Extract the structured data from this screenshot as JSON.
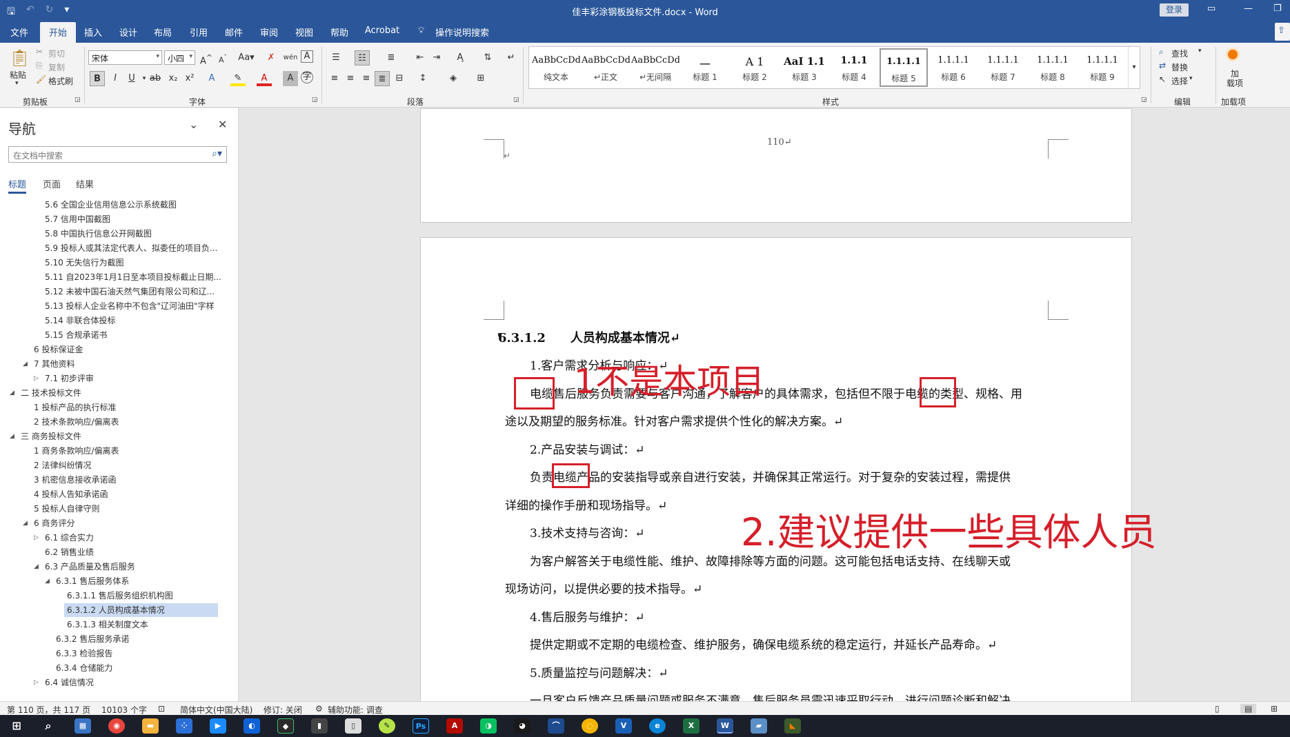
{
  "window": {
    "title": "佳丰彩涂钢板投标文件.docx  -  Word",
    "login_label": "登录",
    "quick_access": [
      "save-icon",
      "undo-icon",
      "redo-icon",
      "customize-icon"
    ]
  },
  "tabs": [
    "文件",
    "开始",
    "插入",
    "设计",
    "布局",
    "引用",
    "邮件",
    "审阅",
    "视图",
    "帮助",
    "Acrobat"
  ],
  "active_tab": "开始",
  "tell_me": "操作说明搜索",
  "ribbon": {
    "clipboard": {
      "paste": "粘贴",
      "cut": "剪切",
      "copy": "复制",
      "format_painter": "格式刷",
      "label": "剪贴板"
    },
    "font": {
      "name": "宋体",
      "size": "小四",
      "label": "字体"
    },
    "paragraph": {
      "label": "段落"
    },
    "styles": {
      "label": "样式",
      "items": [
        {
          "preview": "AaBbCcDdI",
          "name": "纯文本"
        },
        {
          "preview": "AaBbCcDdI",
          "name": "↵正文"
        },
        {
          "preview": "AaBbCcDdI",
          "name": "↵无间隔"
        },
        {
          "preview": "一",
          "name": "标题 1"
        },
        {
          "preview": "A 1",
          "name": "标题 2"
        },
        {
          "preview": "AaI 1.1",
          "name": "标题 3"
        },
        {
          "preview": "1.1.1",
          "name": "标题 4"
        },
        {
          "preview": "1.1.1.1",
          "name": "标题 5"
        },
        {
          "preview": "1.1.1.1",
          "name": "标题 6"
        },
        {
          "preview": "1.1.1.1",
          "name": "标题 7"
        },
        {
          "preview": "1.1.1.1",
          "name": "标题 8"
        },
        {
          "preview": "1.1.1.1",
          "name": "标题 9"
        }
      ],
      "selected_index": 7
    },
    "editing": {
      "find": "查找",
      "replace": "替换",
      "select": "选择",
      "label": "编辑"
    },
    "addins": {
      "button": "加\n载项",
      "label": "加载项"
    }
  },
  "nav": {
    "title": "导航",
    "search_placeholder": "在文档中搜索",
    "tabs": [
      "标题",
      "页面",
      "结果"
    ],
    "items": [
      {
        "text": "5.6 全国企业信用信息公示系统截图",
        "level": 3,
        "tri": ""
      },
      {
        "text": "5.7 信用中国截图",
        "level": 3,
        "tri": ""
      },
      {
        "text": "5.8 中国执行信息公开网截图",
        "level": 3,
        "tri": ""
      },
      {
        "text": "5.9 投标人或其法定代表人、拟委任的项目负...",
        "level": 3,
        "tri": ""
      },
      {
        "text": "5.10 无失信行为截图",
        "level": 3,
        "tri": ""
      },
      {
        "text": "5.11 自2023年1月1日至本项目投标截止日期...",
        "level": 3,
        "tri": ""
      },
      {
        "text": "5.12 未被中国石油天然气集团有限公司和辽...",
        "level": 3,
        "tri": ""
      },
      {
        "text": "5.13 投标人企业名称中不包含\"辽河油田\"字样",
        "level": 3,
        "tri": ""
      },
      {
        "text": "5.14 非联合体投标",
        "level": 3,
        "tri": ""
      },
      {
        "text": "5.15 合规承诺书",
        "level": 3,
        "tri": ""
      },
      {
        "text": "6 投标保证金",
        "level": 2,
        "tri": ""
      },
      {
        "text": "7 其他资料",
        "level": 2,
        "tri": "open"
      },
      {
        "text": "7.1 初步评审",
        "level": 3,
        "tri": "closed"
      },
      {
        "text": "二 技术投标文件",
        "level": 1,
        "tri": "open"
      },
      {
        "text": "1 投标产品的执行标准",
        "level": 2,
        "tri": ""
      },
      {
        "text": "2 技术条款响应/偏离表",
        "level": 2,
        "tri": ""
      },
      {
        "text": "三 商务投标文件",
        "level": 1,
        "tri": "open"
      },
      {
        "text": "1 商务条款响应/偏离表",
        "level": 2,
        "tri": ""
      },
      {
        "text": "2 法律纠纷情况",
        "level": 2,
        "tri": ""
      },
      {
        "text": "3 机密信息接收承诺函",
        "level": 2,
        "tri": ""
      },
      {
        "text": "4 投标人告知承诺函",
        "level": 2,
        "tri": ""
      },
      {
        "text": "5 投标人自律守则",
        "level": 2,
        "tri": ""
      },
      {
        "text": "6 商务评分",
        "level": 2,
        "tri": "open"
      },
      {
        "text": "6.1 综合实力",
        "level": 3,
        "tri": "closed"
      },
      {
        "text": "6.2 销售业绩",
        "level": 3,
        "tri": ""
      },
      {
        "text": "6.3 产品质量及售后服务",
        "level": 3,
        "tri": "open"
      },
      {
        "text": "6.3.1 售后服务体系",
        "level": 4,
        "tri": "open"
      },
      {
        "text": "6.3.1.1 售后服务组织机构图",
        "level": 5,
        "tri": ""
      },
      {
        "text": "6.3.1.2 人员构成基本情况",
        "level": 5,
        "tri": "",
        "selected": true
      },
      {
        "text": "6.3.1.3 相关制度文本",
        "level": 5,
        "tri": ""
      },
      {
        "text": "6.3.2 售后服务承诺",
        "level": 4,
        "tri": ""
      },
      {
        "text": "6.3.3 检验报告",
        "level": 4,
        "tri": ""
      },
      {
        "text": "6.3.4 仓储能力",
        "level": 4,
        "tri": ""
      },
      {
        "text": "6.4 诚信情况",
        "level": 3,
        "tri": "closed"
      }
    ]
  },
  "document": {
    "page_number": "110↵",
    "heading": "6.3.1.2　　人员构成基本情况↵",
    "paragraphs": [
      {
        "text": "1.客户需求分析与响应：↵",
        "indent": true
      },
      {
        "text": "电缆售后服务负责需要与客户沟通，了解客户的具体需求，包括但不限于电缆的类型、规格、用",
        "indent": true
      },
      {
        "text": "途以及期望的服务标准。针对客户需求提供个性化的解决方案。↵",
        "indent": false
      },
      {
        "text": "2.产品安装与调试：↵",
        "indent": true
      },
      {
        "text": "负责电缆产品的安装指导或亲自进行安装，并确保其正常运行。对于复杂的安装过程，需提供",
        "indent": true
      },
      {
        "text": "详细的操作手册和现场指导。↵",
        "indent": false
      },
      {
        "text": "3.技术支持与咨询：↵",
        "indent": true
      },
      {
        "text": "为客户解答关于电缆性能、维护、故障排除等方面的问题。这可能包括电话支持、在线聊天或",
        "indent": true
      },
      {
        "text": "现场访问，以提供必要的技术指导。↵",
        "indent": false
      },
      {
        "text": "4.售后服务与维护：↵",
        "indent": true
      },
      {
        "text": "提供定期或不定期的电缆检查、维护服务，确保电缆系统的稳定运行，并延长产品寿命。↵",
        "indent": true
      },
      {
        "text": "5.质量监控与问题解决：↵",
        "indent": true
      },
      {
        "text": "一旦客户反馈产品质量问题或服务不满意，售后服务员需迅速采取行动，进行问题诊断和解决",
        "indent": true
      }
    ],
    "annotations": [
      "1不是本项目",
      "2.建议提供一些具体人员"
    ],
    "annotation_color": "#d51f2a"
  },
  "status": {
    "page": "第 110 页，共 117 页",
    "words": "10103 个字",
    "language": "简体中文(中国大陆)",
    "track_changes": "修订: 关闭",
    "accessibility": "辅助功能: 调查"
  },
  "taskbar": [
    "windows-icon",
    "search-icon",
    "calculator-icon",
    "chrome-icon",
    "folder-icon",
    "app-icon",
    "tencent-meeting-icon",
    "app-icon",
    "app-icon",
    "app-icon",
    "file-icon",
    "app-icon",
    "photoshop-icon",
    "acrobat-icon",
    "wechat-icon",
    "qq-icon",
    "app-icon",
    "app-icon",
    "app-icon",
    "edge-icon",
    "excel-icon",
    "word-icon",
    "app-icon",
    "app-icon"
  ]
}
